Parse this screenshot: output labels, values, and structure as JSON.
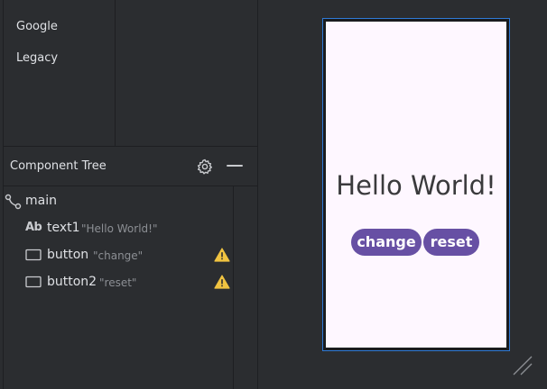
{
  "palette": {
    "categories": [
      "Google",
      "Legacy"
    ]
  },
  "component_tree": {
    "title": "Component Tree",
    "icons": {
      "settings": "gear-icon",
      "minimize": "minimize-icon"
    },
    "nodes": [
      {
        "id": "main",
        "label": "main",
        "hint": "",
        "icon": "constraint-layout-icon",
        "warning": false
      },
      {
        "id": "text1",
        "label": "text1",
        "hint": "\"Hello World!\"",
        "icon": "textview-icon",
        "icon_text": "Ab",
        "warning": false
      },
      {
        "id": "button",
        "label": "button",
        "hint": "\"change\"",
        "icon": "button-icon",
        "warning": true
      },
      {
        "id": "button2",
        "label": "button2",
        "hint": "\"reset\"",
        "icon": "button-icon",
        "warning": true
      }
    ]
  },
  "preview": {
    "text": "Hello World!",
    "buttons": [
      "change",
      "reset"
    ]
  },
  "colors": {
    "background": "#2b2d30",
    "screen": "#fef7ff",
    "button": "#6750a4",
    "selection_border": "#2f7ad6",
    "warning": "#f0c341"
  }
}
